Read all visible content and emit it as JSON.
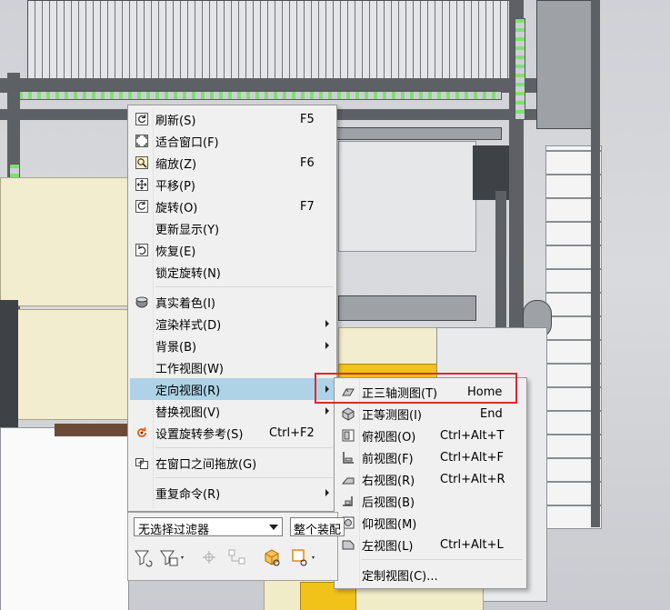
{
  "context_menu": {
    "items": [
      {
        "label": "刷新(S)",
        "shortcut": "F5",
        "icon": "refresh-icon"
      },
      {
        "label": "适合窗口(F)",
        "shortcut": "",
        "icon": "fit-window-icon"
      },
      {
        "label": "缩放(Z)",
        "shortcut": "F6",
        "icon": "zoom-icon"
      },
      {
        "label": "平移(P)",
        "shortcut": "",
        "icon": "pan-icon"
      },
      {
        "label": "旋转(O)",
        "shortcut": "F7",
        "icon": "rotate-icon"
      },
      {
        "label": "更新显示(Y)",
        "shortcut": "",
        "icon": ""
      },
      {
        "label": "恢复(E)",
        "shortcut": "",
        "icon": "restore-icon"
      },
      {
        "label": "锁定旋转(N)",
        "shortcut": "",
        "icon": ""
      },
      {
        "label": "真实着色(I)",
        "shortcut": "",
        "icon": "true-shading-icon"
      },
      {
        "label": "渲染样式(D)",
        "shortcut": "",
        "icon": ""
      },
      {
        "label": "背景(B)",
        "shortcut": "",
        "icon": ""
      },
      {
        "label": "工作视图(W)",
        "shortcut": "",
        "icon": ""
      },
      {
        "label": "定向视图(R)",
        "shortcut": "",
        "icon": ""
      },
      {
        "label": "替换视图(V)",
        "shortcut": "",
        "icon": ""
      },
      {
        "label": "设置旋转参考(S)",
        "shortcut": "Ctrl+F2",
        "icon": "rotate-reference-icon"
      },
      {
        "label": "在窗口之间拖放(G)",
        "shortcut": "",
        "icon": "drag-drop-icon"
      },
      {
        "label": "重复命令(R)",
        "shortcut": "",
        "icon": ""
      }
    ]
  },
  "submenu": {
    "items": [
      {
        "label": "正三轴测图(T)",
        "shortcut": "Home",
        "icon": "trimetric-icon"
      },
      {
        "label": "正等测图(I)",
        "shortcut": "End",
        "icon": "isometric-icon"
      },
      {
        "label": "俯视图(O)",
        "shortcut": "Ctrl+Alt+T",
        "icon": "top-view-icon"
      },
      {
        "label": "前视图(F)",
        "shortcut": "Ctrl+Alt+F",
        "icon": "front-view-icon"
      },
      {
        "label": "右视图(R)",
        "shortcut": "Ctrl+Alt+R",
        "icon": "right-view-icon"
      },
      {
        "label": "后视图(B)",
        "shortcut": "",
        "icon": "back-view-icon"
      },
      {
        "label": "仰视图(M)",
        "shortcut": "",
        "icon": "bottom-view-icon"
      },
      {
        "label": "左视图(L)",
        "shortcut": "Ctrl+Alt+L",
        "icon": "left-view-icon"
      },
      {
        "label": "定制视图(C)...",
        "shortcut": "",
        "icon": ""
      }
    ]
  },
  "filter_bar": {
    "filter_value": "无选择过滤器",
    "scope_value": "整个装配"
  },
  "colors": {
    "menu_bg": "#f0f0f0",
    "highlight": "#aed3e6",
    "annotation_red": "#e3262d"
  }
}
